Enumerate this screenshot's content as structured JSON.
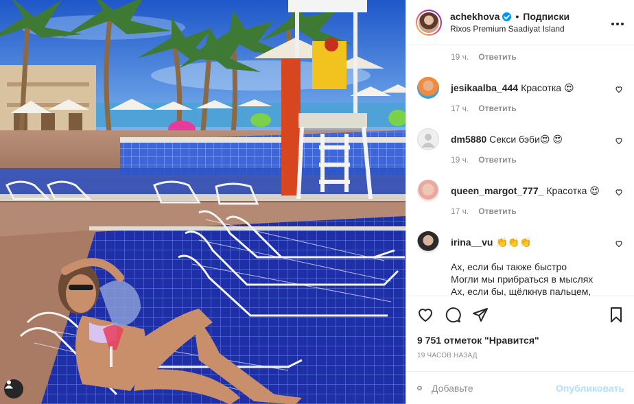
{
  "post": {
    "author": "achekhova",
    "follow_label": "Подписки",
    "location": "Rixos Premium Saadiyat Island",
    "likes": "9 751 отметок \"Нравится\"",
    "time_ago": "19 ЧАСОВ НАЗАД"
  },
  "comments": {
    "reply_label": "Ответить",
    "first_meta_time": "19 ч.",
    "items": [
      {
        "user": "jesikaalba_444",
        "text": "Красотка 😍",
        "time": "17 ч.",
        "avatar_color": "#f4a35c"
      },
      {
        "user": "dm5880",
        "text": "Секси бэби😍 😍",
        "time": "19 ч.",
        "avatar_color": "#dbdbdb"
      },
      {
        "user": "queen_margot_777_",
        "text": "Красотка 😍",
        "time": "17 ч.",
        "avatar_color": "#f3cfc4"
      },
      {
        "user": "irina__vu",
        "text": "👏👏👏",
        "lines": [
          "Ах, если бы также быстро",
          "Могли мы прибраться в мыслях",
          "Ах, если бы, щёлкнув пальцем,"
        ],
        "avatar_color": "#5b5b5b"
      }
    ]
  },
  "comment_box": {
    "placeholder": "Добавьте",
    "publish_label": "Опубликовать"
  },
  "icons": [
    "more-icon",
    "heart-icon",
    "comment-icon",
    "share-icon",
    "bookmark-icon",
    "emoji-icon",
    "user-tag-icon",
    "verified-icon"
  ],
  "colors": {
    "accent": "#0095f6",
    "muted": "#8e8e8e",
    "publish_disabled": "#b2dffc"
  }
}
